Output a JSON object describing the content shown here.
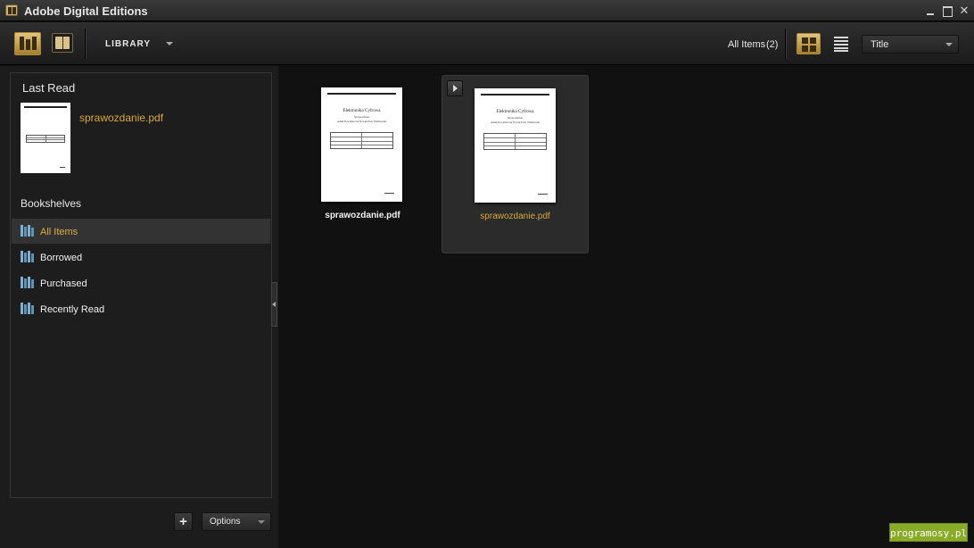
{
  "window": {
    "title": "Adobe Digital Editions"
  },
  "toolbar": {
    "section_label": "LIBRARY",
    "filter_label": "All Items",
    "count": "(2)",
    "sort_value": "Title"
  },
  "sidebar": {
    "last_read": {
      "title": "Last Read",
      "item_name": "sprawozdanie.pdf"
    },
    "bookshelves_title": "Bookshelves",
    "shelves": [
      {
        "label": "All Items",
        "selected": true
      },
      {
        "label": "Borrowed",
        "selected": false
      },
      {
        "label": "Purchased",
        "selected": false
      },
      {
        "label": "Recently Read",
        "selected": false
      }
    ],
    "add_label": "+",
    "options_label": "Options"
  },
  "library": {
    "items": [
      {
        "name": "sprawozdanie.pdf"
      },
      {
        "name": "sprawozdanie.pdf"
      }
    ],
    "doc": {
      "line1": "Elektronika Cyfrowa",
      "line2": "Sprawozdanie",
      "line3": "Adam Kowalski Jan Nowak Piotr Wiśniewski"
    }
  },
  "watermark": {
    "text": "programosy.pl"
  },
  "colors": {
    "accent": "#d9a73a",
    "shelf_icon": "#7fb0d0",
    "background": "#111111",
    "watermark": "#8aab2a"
  },
  "icons": {
    "app": "book-app-icon",
    "library_view": "library-view-icon",
    "reading_view": "reading-view-icon",
    "grid_view": "grid-view-icon",
    "list_view": "list-view-icon",
    "shelf": "bookshelf-icon",
    "play": "play-icon"
  }
}
